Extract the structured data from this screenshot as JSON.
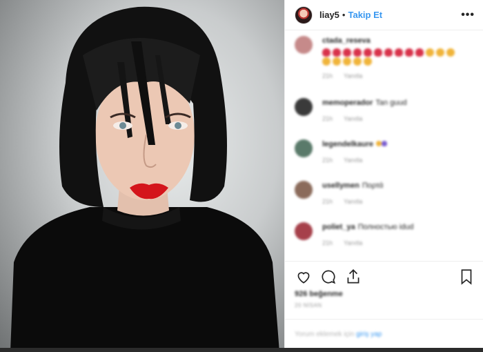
{
  "post": {
    "username": "liay5",
    "separator": "•",
    "follow_label": "Takip Et",
    "more_label": "•••"
  },
  "comments": [
    {
      "user": "ctada_reseva",
      "text": "",
      "time": "21h",
      "reply": "Yanıtla"
    },
    {
      "user": "memoperador",
      "text": "Tan guud",
      "time": "21h",
      "reply": "Yanıtla"
    },
    {
      "user": "legendelkaure",
      "text": "",
      "time": "21h",
      "reply": "Yanıtla"
    },
    {
      "user": "usellymen",
      "text": "Πορτά",
      "time": "21h",
      "reply": "Yanıtla"
    },
    {
      "user": "poliet_ya",
      "text": "Полностью idud",
      "time": "21h",
      "reply": "Yanıtla"
    }
  ],
  "footer": {
    "likes": "926 beğenme",
    "date": "20 NİSAN",
    "add_comment_placeholder": "Yorum eklemek için",
    "add_comment_link": "giriş yap"
  },
  "icons": [
    "heart-icon",
    "comment-icon",
    "share-icon",
    "bookmark-icon",
    "more-icon"
  ]
}
